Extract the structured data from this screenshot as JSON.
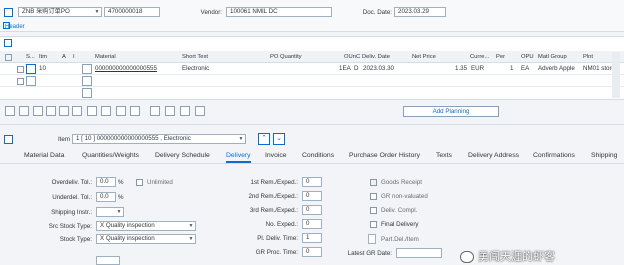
{
  "header": {
    "doc_type": "ZNB 采购订单PO",
    "po_number": "4700000018",
    "vendor_label": "Vendor:",
    "vendor_value": "100061 NMIL DC",
    "doc_date_label": "Doc. Date:",
    "doc_date_value": "2023.03.29",
    "header_label": "Header"
  },
  "items_table": {
    "columns": [
      "S...",
      "Itm",
      "A",
      "I",
      "Material",
      "Short Text",
      "PO Quantity",
      "OUn",
      "C",
      "Deliv. Date",
      "Net Price",
      "Curre...",
      "Per",
      "OPU",
      "Matl Group",
      "Plnt"
    ],
    "rows": [
      {
        "item": "10",
        "material": "000000000000000555",
        "short_text": "Electronic",
        "oun": "1EA",
        "c": "D",
        "deliv_date": "2023.03.30",
        "net_price": "1.35",
        "currency": "EUR",
        "per": "1",
        "opu": "EA",
        "matl_group": "Adverb Apple",
        "plant": "NM01 store"
      }
    ]
  },
  "toolbar": {
    "add_planning": "Add Planning"
  },
  "item_detail": {
    "item_label": "Item",
    "item_value": "1 [ 10 ] 000000000000000555 , Electronic",
    "tabs": [
      "Material Data",
      "Quantities/Weights",
      "Delivery Schedule",
      "Delivery",
      "Invoice",
      "Conditions",
      "Purchase Order History",
      "Texts",
      "Delivery Address",
      "Confirmations",
      "Shipping"
    ],
    "active_tab": "Delivery"
  },
  "delivery": {
    "overdeliv_label": "Overdeliv. Tol.:",
    "overdeliv_value": "0.0",
    "unlimited_label": "Unlimited",
    "underdel_label": "Underdel. Tol.:",
    "underdel_value": "0.0",
    "percent": "%",
    "shipping_instr_label": "Shipping Instr.:",
    "src_stock_label": "Src Stock Type:",
    "src_stock_value": "X Quality inspection",
    "stock_type_label": "Stock Type:",
    "stock_type_value": "X Quality inspection",
    "rem1_label": "1st Rem./Exped.:",
    "rem1_value": "0",
    "rem2_label": "2nd Rem./Exped.:",
    "rem2_value": "0",
    "rem3_label": "3rd Rem./Exped.:",
    "rem3_value": "0",
    "no_exped_label": "No. Exped.:",
    "no_exped_value": "0",
    "pl_deliv_label": "Pl. Deliv. Time:",
    "pl_deliv_value": "1",
    "gr_proc_label": "GR Proc. Time:",
    "gr_proc_value": "0",
    "goods_receipt_label": "Goods Receipt",
    "gr_non_valuated_label": "GR non-valuated",
    "deliv_compl_label": "Deliv. Compl.",
    "final_delivery_label": "Final Delivery",
    "part_del_label": "Part.Del./Item",
    "latest_gr_label": "Latest GR Date:"
  },
  "watermark": "勇闯天涯的虾客"
}
